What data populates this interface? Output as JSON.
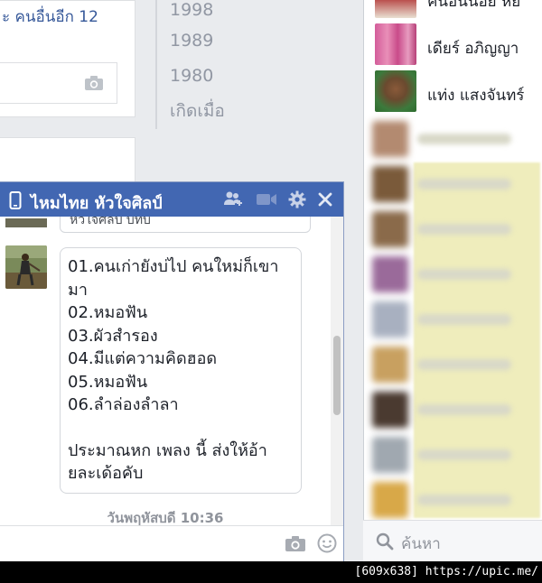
{
  "feed": {
    "tagline": "ะ คนอื่นอีก 12",
    "comment_icon": "camera-icon"
  },
  "years": [
    "1998",
    "1989",
    "1980",
    "เกิดเมื่อ"
  ],
  "sidebar": {
    "contacts": [
      {
        "name": "คนอนนอย หย"
      },
      {
        "name": "เดียร์ อภิญญา"
      },
      {
        "name": "แท่ง แสงจันทร์"
      }
    ],
    "search_placeholder": "ค้นหา"
  },
  "chat": {
    "title": "ไหมไทย หัวใจศิลป์",
    "header_icons": [
      "add-friend-icon",
      "video-call-icon",
      "gear-icon",
      "close-icon"
    ],
    "previous_message": "หัวใจศิลป์ บัทบ",
    "message_lines": [
      "01.คนเก่ายังบ่ไป คนใหม่ก็เขา",
      "มา",
      "02.หมอฟัน",
      "03.ผัวสำรอง",
      "04.มีแต่ความคิดฮอด",
      "05.หมอฟัน",
      "06.ลำล่องลำลา"
    ],
    "message_tail": [
      "ประมาณหก เพลง นี้ ส่งให้อ้า",
      "ยละเด้อคับ"
    ],
    "timestamp": "วันพฤหัสบดี 10:36",
    "footer_icons": [
      "camera-icon",
      "emoji-icon"
    ]
  },
  "watermark": "[609x638] https://upic.me/",
  "colors": {
    "header": "#4267b2",
    "link": "#365899",
    "muted": "#9197a3"
  }
}
